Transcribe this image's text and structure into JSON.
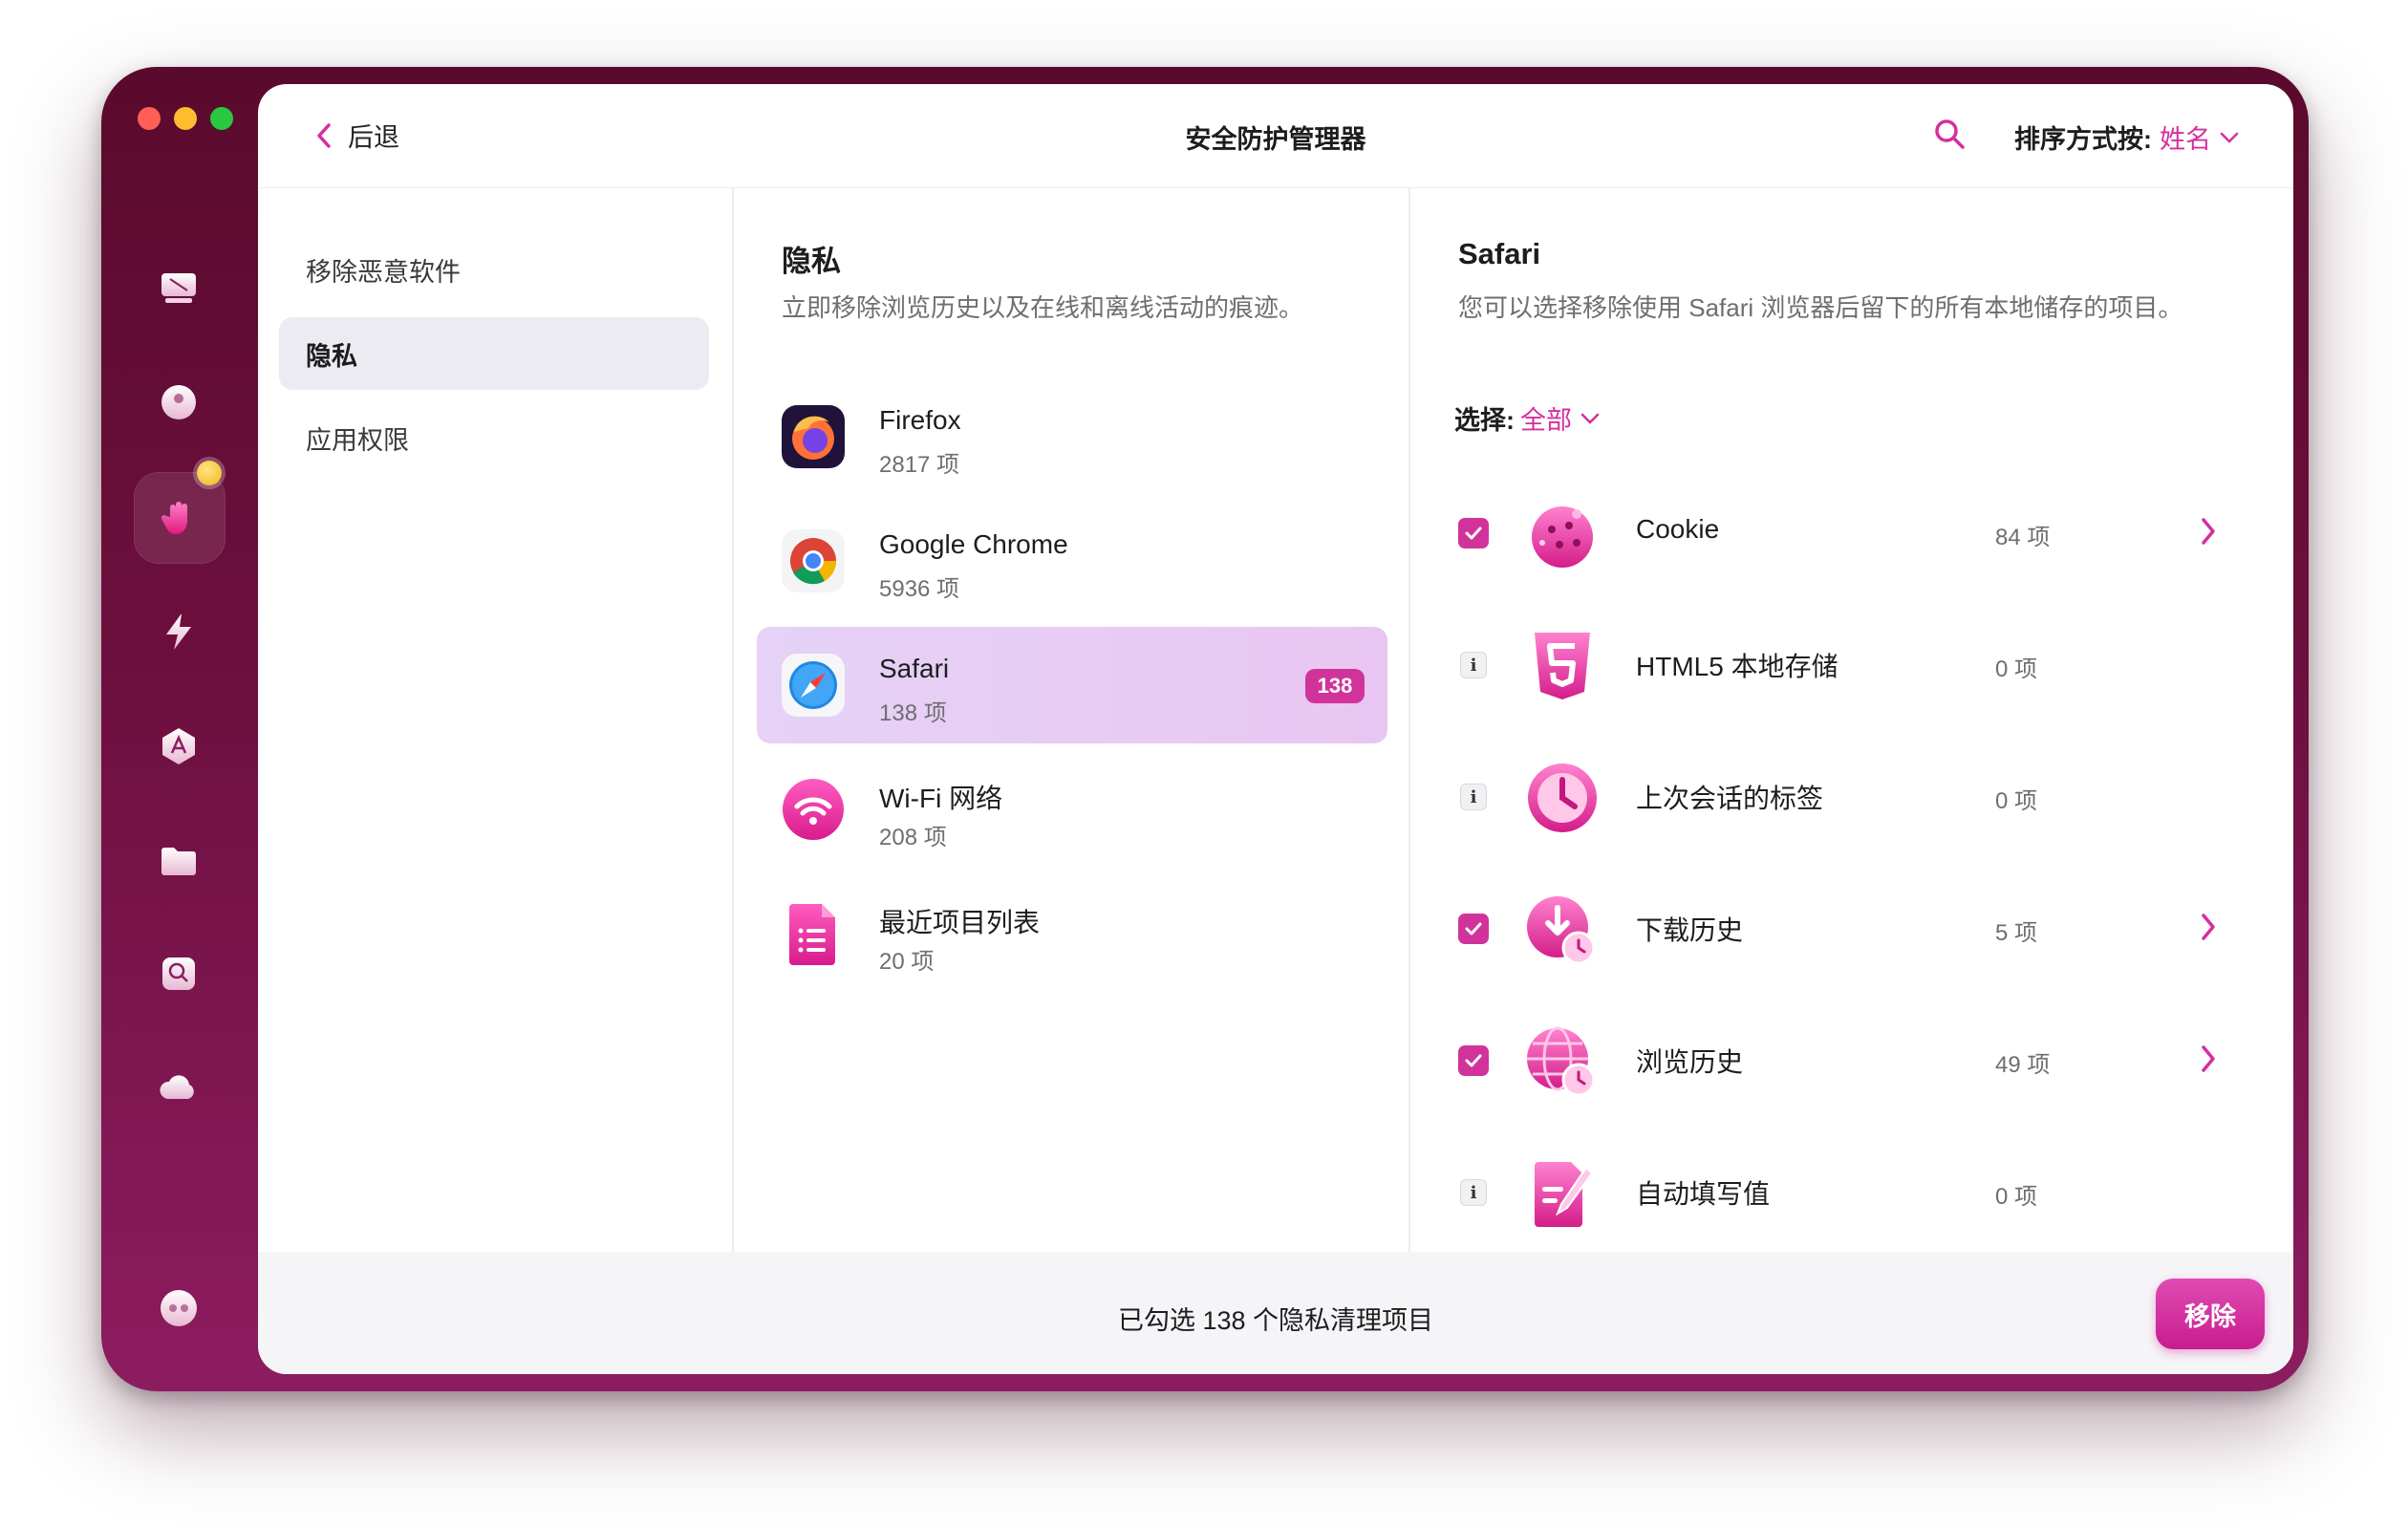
{
  "header": {
    "back_label": "后退",
    "title": "安全防护管理器",
    "sort_label": "排序方式按:",
    "sort_value": "姓名"
  },
  "sidebar": {
    "items": [
      {
        "label": "移除恶意软件",
        "active": false
      },
      {
        "label": "隐私",
        "active": true
      },
      {
        "label": "应用权限",
        "active": false
      }
    ]
  },
  "privacy": {
    "title": "隐私",
    "description": "立即移除浏览历史以及在线和离线活动的痕迹。",
    "apps": [
      {
        "name": "Firefox",
        "count": "2817 项",
        "icon": "firefox-icon"
      },
      {
        "name": "Google Chrome",
        "count": "5936 项",
        "icon": "chrome-icon"
      },
      {
        "name": "Safari",
        "count": "138 项",
        "icon": "safari-icon",
        "badge": "138",
        "selected": true
      },
      {
        "name": "Wi-Fi 网络",
        "count": "208 项",
        "icon": "wifi-icon"
      },
      {
        "name": "最近项目列表",
        "count": "20 项",
        "icon": "document-list-icon"
      }
    ]
  },
  "detail": {
    "title": "Safari",
    "description": "您可以选择移除使用 Safari 浏览器后留下的所有本地储存的项目。",
    "select_label": "选择:",
    "select_value": "全部",
    "items": [
      {
        "name": "Cookie",
        "count": "84 项",
        "checked": true,
        "icon": "cookie-icon"
      },
      {
        "name": "HTML5 本地存储",
        "count": "0 项",
        "checked": false,
        "icon": "html5-icon"
      },
      {
        "name": "上次会话的标签",
        "count": "0 项",
        "checked": false,
        "icon": "clock-icon"
      },
      {
        "name": "下载历史",
        "count": "5 项",
        "checked": true,
        "icon": "download-history-icon"
      },
      {
        "name": "浏览历史",
        "count": "49 项",
        "checked": true,
        "icon": "globe-history-icon"
      },
      {
        "name": "自动填写值",
        "count": "0 项",
        "checked": false,
        "icon": "autofill-icon"
      }
    ]
  },
  "footer": {
    "summary": "已勾选 138 个隐私清理项目",
    "remove_label": "移除"
  },
  "colors": {
    "accent": "#d1339b",
    "window_dark": "#5a0a2c",
    "window_light": "#8c1c60"
  }
}
